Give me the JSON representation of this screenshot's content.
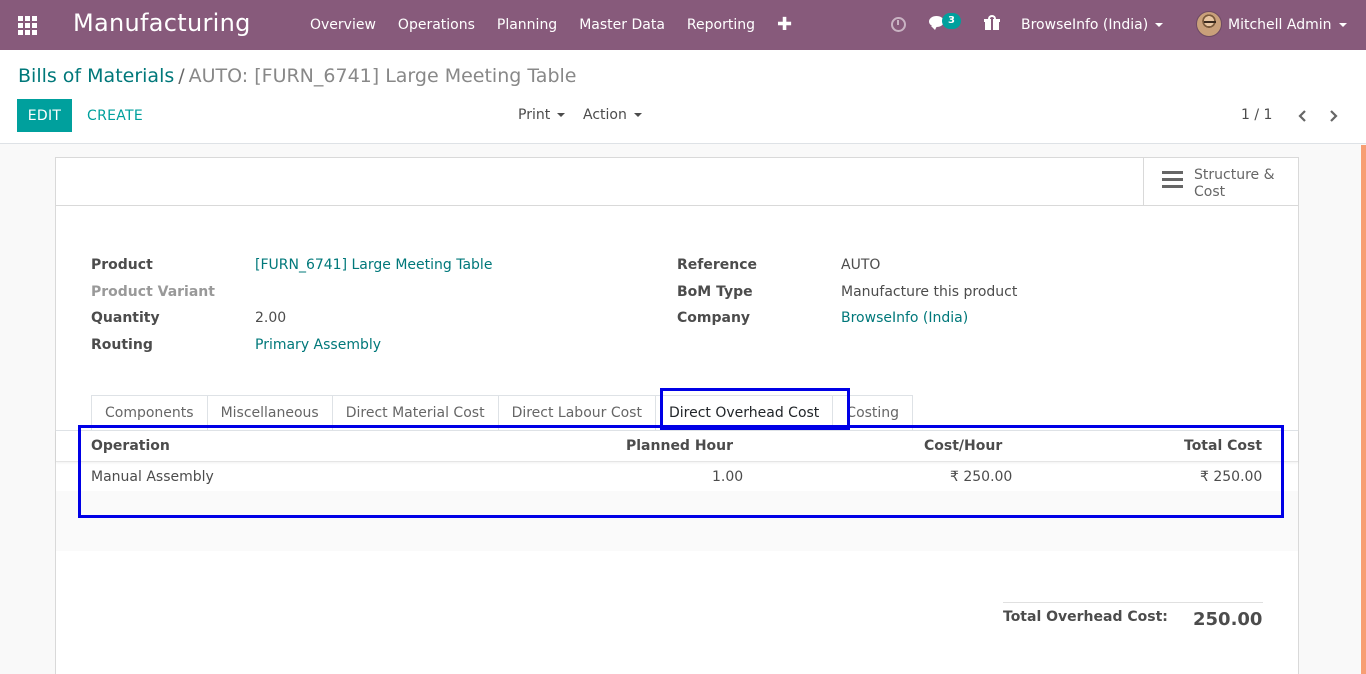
{
  "navbar": {
    "app_name": "Manufacturing",
    "menu": [
      "Overview",
      "Operations",
      "Planning",
      "Master Data",
      "Reporting"
    ],
    "plus_glyph": "✚",
    "messages_count": "3",
    "company": "BrowseInfo (India)",
    "user": "Mitchell Admin",
    "icons": [
      "apps-grid-icon",
      "clock-icon",
      "chat-icon",
      "gift-icon",
      "avatar"
    ],
    "color": "#875a7b"
  },
  "control_panel": {
    "breadcrumb_parent": "Bills of Materials",
    "breadcrumb_separator": "/",
    "breadcrumb_current": "AUTO: [FURN_6741] Large Meeting Table",
    "edit_label": "EDIT",
    "create_label": "CREATE",
    "print_label": "Print",
    "action_label": "Action",
    "pager": "1 / 1"
  },
  "smart_button": {
    "line1": "Structure &",
    "line2": "Cost"
  },
  "form": {
    "left": [
      {
        "label": "Product",
        "value": "[FURN_6741] Large Meeting Table"
      },
      {
        "label": "Product Variant",
        "value": ""
      },
      {
        "label": "Quantity",
        "value": "2.00"
      },
      {
        "label": "Routing",
        "value": "Primary Assembly"
      }
    ],
    "right": [
      {
        "label": "Reference",
        "value": "AUTO"
      },
      {
        "label": "BoM Type",
        "value": "Manufacture this product"
      },
      {
        "label": "Company",
        "value": "BrowseInfo (India)"
      }
    ]
  },
  "tabs": [
    "Components",
    "Miscellaneous",
    "Direct Material Cost",
    "Direct Labour Cost",
    "Direct Overhead Cost",
    "Costing"
  ],
  "active_tab": "Direct Overhead Cost",
  "overhead_table": {
    "columns": [
      "Operation",
      "Planned Hour",
      "Cost/Hour",
      "Total Cost"
    ],
    "rows": [
      [
        "Manual Assembly",
        "1.00",
        "₹ 250.00",
        "₹ 250.00"
      ]
    ]
  },
  "total": {
    "label": "Total Overhead Cost:",
    "value": "250.00"
  },
  "colors": {
    "primary": "#00a09d",
    "link": "#00787a",
    "highlight": "#0000e6"
  }
}
